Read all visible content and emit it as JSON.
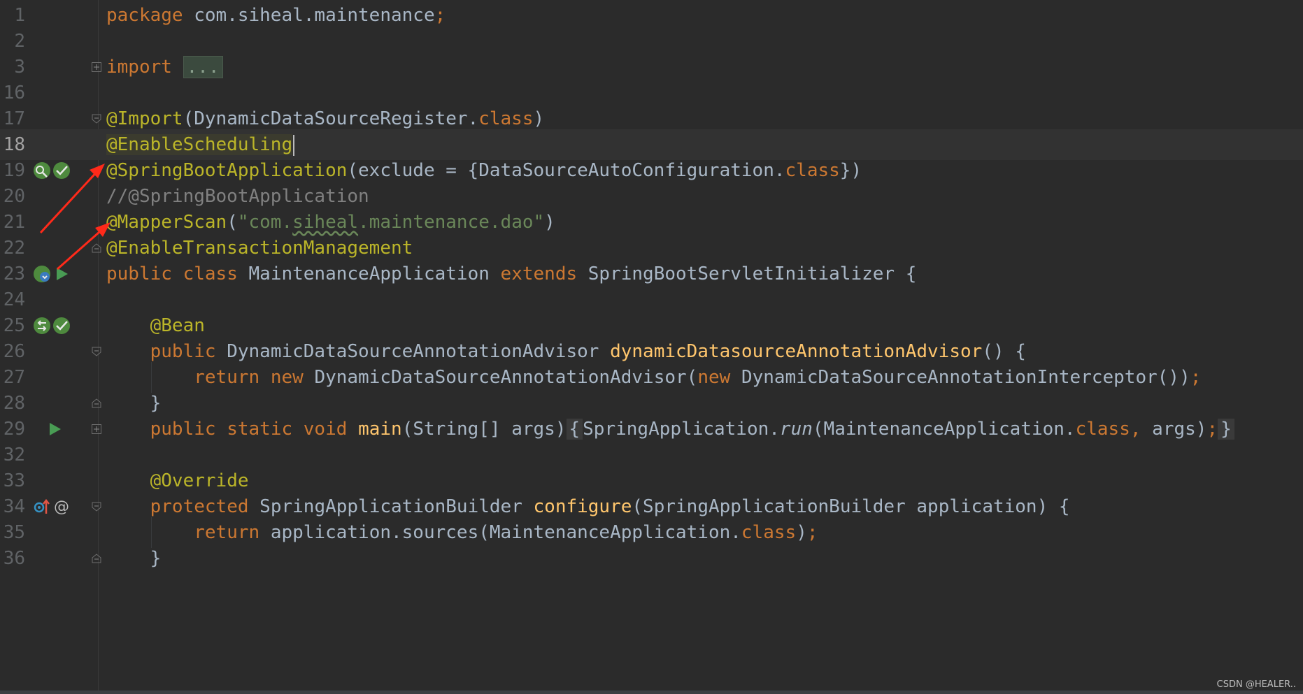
{
  "editor": {
    "language": "java",
    "current_line": "18",
    "lines": [
      {
        "n": "1"
      },
      {
        "n": "2"
      },
      {
        "n": "3"
      },
      {
        "n": "16"
      },
      {
        "n": "17"
      },
      {
        "n": "18"
      },
      {
        "n": "19"
      },
      {
        "n": "20"
      },
      {
        "n": "21"
      },
      {
        "n": "22"
      },
      {
        "n": "23"
      },
      {
        "n": "24"
      },
      {
        "n": "25"
      },
      {
        "n": "26"
      },
      {
        "n": "27"
      },
      {
        "n": "28"
      },
      {
        "n": "29"
      },
      {
        "n": "32"
      },
      {
        "n": "33"
      },
      {
        "n": "34"
      },
      {
        "n": "35"
      },
      {
        "n": "36"
      }
    ],
    "code": {
      "l1_pkg": "package",
      "l1_name": " com.siheal.maintenance",
      "l1_semi": ";",
      "l3_import": "import",
      "l3_fold": "...",
      "l17_ann": "@Import",
      "l17_a": "(DynamicDataSourceRegister.",
      "l17_class": "class",
      "l17_b": ")",
      "l18_ann": "@EnableScheduling",
      "l19_ann": "@SpringBootApplication",
      "l19_a": "(exclude = {DataSourceAutoConfiguration.",
      "l19_class": "class",
      "l19_b": "})",
      "l20_comment": "//@SpringBootApplication",
      "l21_ann": "@MapperScan",
      "l21_a": "(",
      "l21_str1": "\"com.",
      "l21_str2": "siheal",
      "l21_str3": ".maintenance.dao\"",
      "l21_b": ")",
      "l22_ann": "@EnableTransactionManagement",
      "l23_public": "public",
      "l23_class": "class",
      "l23_name": "MaintenanceApplication",
      "l23_extends": "extends",
      "l23_rest": "SpringBootServletInitializer {",
      "l25_ann": "@Bean",
      "l26_public": "public",
      "l26_type": "DynamicDataSourceAnnotationAdvisor",
      "l26_fn": "dynamicDatasourceAnnotationAdvisor",
      "l26_rest": "() {",
      "l27_return": "return",
      "l27_new": "new",
      "l27_a": "DynamicDataSourceAnnotationAdvisor(",
      "l27_new2": "new",
      "l27_b": "DynamicDataSourceAnnotationInterceptor())",
      "l27_semi": ";",
      "l28": "}",
      "l29_public": "public",
      "l29_static": "static",
      "l29_void": "void",
      "l29_fn": "main",
      "l29_a": "(String[] args)",
      "l29_open": "{",
      "l29_b": "SpringApplication.",
      "l29_run": "run",
      "l29_c": "(MaintenanceApplication.",
      "l29_class": "class",
      "l29_comma": ",",
      "l29_d": " args)",
      "l29_semi": ";",
      "l29_close": "}",
      "l33_ann": "@Override",
      "l34_protected": "protected",
      "l34_type": "SpringApplicationBuilder",
      "l34_fn": "configure",
      "l34_rest": "(SpringApplicationBuilder application) {",
      "l35_return": "return",
      "l35_a": "application.sources(MaintenanceApplication.",
      "l35_class": "class",
      "l35_b": ")",
      "l35_semi": ";",
      "l36": "}"
    }
  },
  "watermark": "CSDN @HEALER..",
  "colors": {
    "background": "#2b2b2b",
    "keyword": "#cc7832",
    "annotation": "#bbb529",
    "string": "#6a8759",
    "comment": "#808080",
    "method": "#ffc66d",
    "arrow": "#ff2a1a"
  },
  "gutter_icons": {
    "l19": [
      "spring-bean-search-icon",
      "spring-bean-check-icon"
    ],
    "l23": [
      "spring-bean-run-icon",
      "run-icon"
    ],
    "l25": [
      "spring-bean-nav-icon",
      "spring-bean-check-icon"
    ],
    "l29": [
      "run-icon"
    ],
    "l34": [
      "override-up-icon",
      "at-icon"
    ]
  }
}
